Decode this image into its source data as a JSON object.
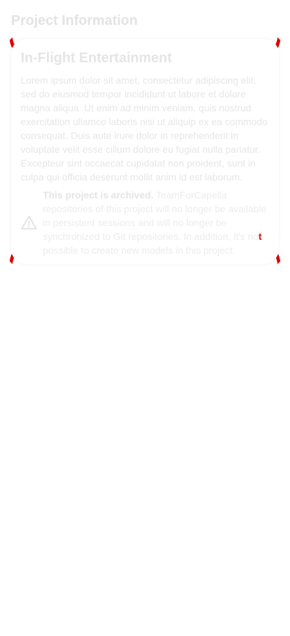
{
  "header": {
    "title": "Project Information"
  },
  "project": {
    "name": "In-Flight Entertainment",
    "description": "Lorem ipsum dolor sit amet, consectetur adipiscing elit, sed do eiusmod tempor incididunt ut labore et dolore magna aliqua. Ut enim ad minim veniam, quis nostrud exercitation ullamco laboris nisi ut aliquip ex ea commodo consequat. Duis aute irure dolor in reprehenderit in voluptate velit esse cillum dolore eu fugiat nulla pariatur. Excepteur sint occaecat cupidatat non proident, sunt in culpa qui officia deserunt mollit anim id est laborum."
  },
  "archive_notice": {
    "icon": "warning-icon",
    "title": "This project is archived.",
    "message_before": "TeamForCapella repositories of this project will no longer be available in persistent sessions and will no longer be synchronized to Git repositories. In addition, it's no",
    "message_highlight": "t",
    "message_after": " possible to create new models in this project."
  },
  "colors": {
    "corner_accent": "#e00000",
    "muted_text": "#e6e6e6"
  }
}
